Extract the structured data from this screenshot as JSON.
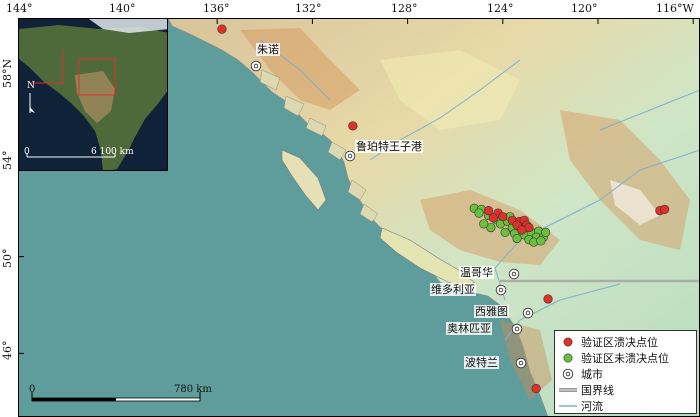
{
  "map": {
    "longitude_ticks": [
      "144°",
      "140°",
      "136°",
      "132°",
      "128°",
      "124°",
      "120°",
      "116°W"
    ],
    "latitude_ticks": [
      "58°N",
      "54°",
      "50°",
      "46°"
    ],
    "colors": {
      "ocean": "#5f9c9c",
      "lowland": "#bfe0c4",
      "midland": "#f2ecb4",
      "upland": "#d7a067",
      "peak": "#f5f1ec",
      "river": "#7fb0cc",
      "border": "#9a9a9a",
      "failed_site": "#e0302a",
      "unfailed_site": "#6cbf3e"
    }
  },
  "cities": [
    {
      "id": "zhunuo",
      "name": "朱诺"
    },
    {
      "id": "prince-rupert",
      "name": "鲁珀特王子港"
    },
    {
      "id": "vancouver",
      "name": "温哥华"
    },
    {
      "id": "victoria",
      "name": "维多利亚"
    },
    {
      "id": "seattle",
      "name": "西雅图"
    },
    {
      "id": "olympia",
      "name": "奥林匹亚"
    },
    {
      "id": "portland",
      "name": "波特兰"
    }
  ],
  "sites": {
    "failed": [
      [
        -135.8,
        59.4
      ],
      [
        -130.3,
        55.4
      ],
      [
        -117.4,
        51.9
      ],
      [
        -117.2,
        51.95
      ],
      [
        -124.6,
        51.9
      ],
      [
        -124.2,
        51.8
      ],
      [
        -124.0,
        51.65
      ],
      [
        -124.4,
        51.6
      ],
      [
        -123.6,
        51.5
      ],
      [
        -123.3,
        51.45
      ],
      [
        -123.1,
        51.5
      ],
      [
        -123.0,
        51.3
      ],
      [
        -123.4,
        51.3
      ],
      [
        -122.9,
        51.2
      ],
      [
        -123.2,
        51.1
      ],
      [
        -122.1,
        48.25
      ],
      [
        -122.6,
        44.55
      ]
    ],
    "unfailed": [
      [
        -125.2,
        52.0
      ],
      [
        -124.9,
        51.95
      ],
      [
        -125.0,
        51.8
      ],
      [
        -124.6,
        51.7
      ],
      [
        -124.3,
        51.55
      ],
      [
        -124.1,
        51.35
      ],
      [
        -123.8,
        51.45
      ],
      [
        -123.6,
        51.2
      ],
      [
        -123.9,
        51.0
      ],
      [
        -123.5,
        50.95
      ],
      [
        -123.1,
        50.9
      ],
      [
        -122.8,
        51.0
      ],
      [
        -122.5,
        51.05
      ],
      [
        -122.6,
        50.8
      ],
      [
        -122.3,
        50.8
      ],
      [
        -122.9,
        50.7
      ],
      [
        -123.4,
        50.75
      ],
      [
        -124.5,
        51.2
      ],
      [
        -124.8,
        51.35
      ],
      [
        -122.2,
        51.0
      ],
      [
        -123.7,
        51.65
      ],
      [
        -122.7,
        50.6
      ],
      [
        -122.4,
        50.65
      ]
    ]
  },
  "inset": {
    "labels": [],
    "scale_label": "6 100 km",
    "north_label": "N"
  },
  "legend": {
    "items": [
      {
        "label": "验证区溃决点位"
      },
      {
        "label": "验证区未溃决点位"
      },
      {
        "label": "城市"
      },
      {
        "label": "国界线"
      },
      {
        "label": "河流"
      }
    ]
  },
  "scalebar": {
    "start_label": "0",
    "end_label": "780 km"
  }
}
